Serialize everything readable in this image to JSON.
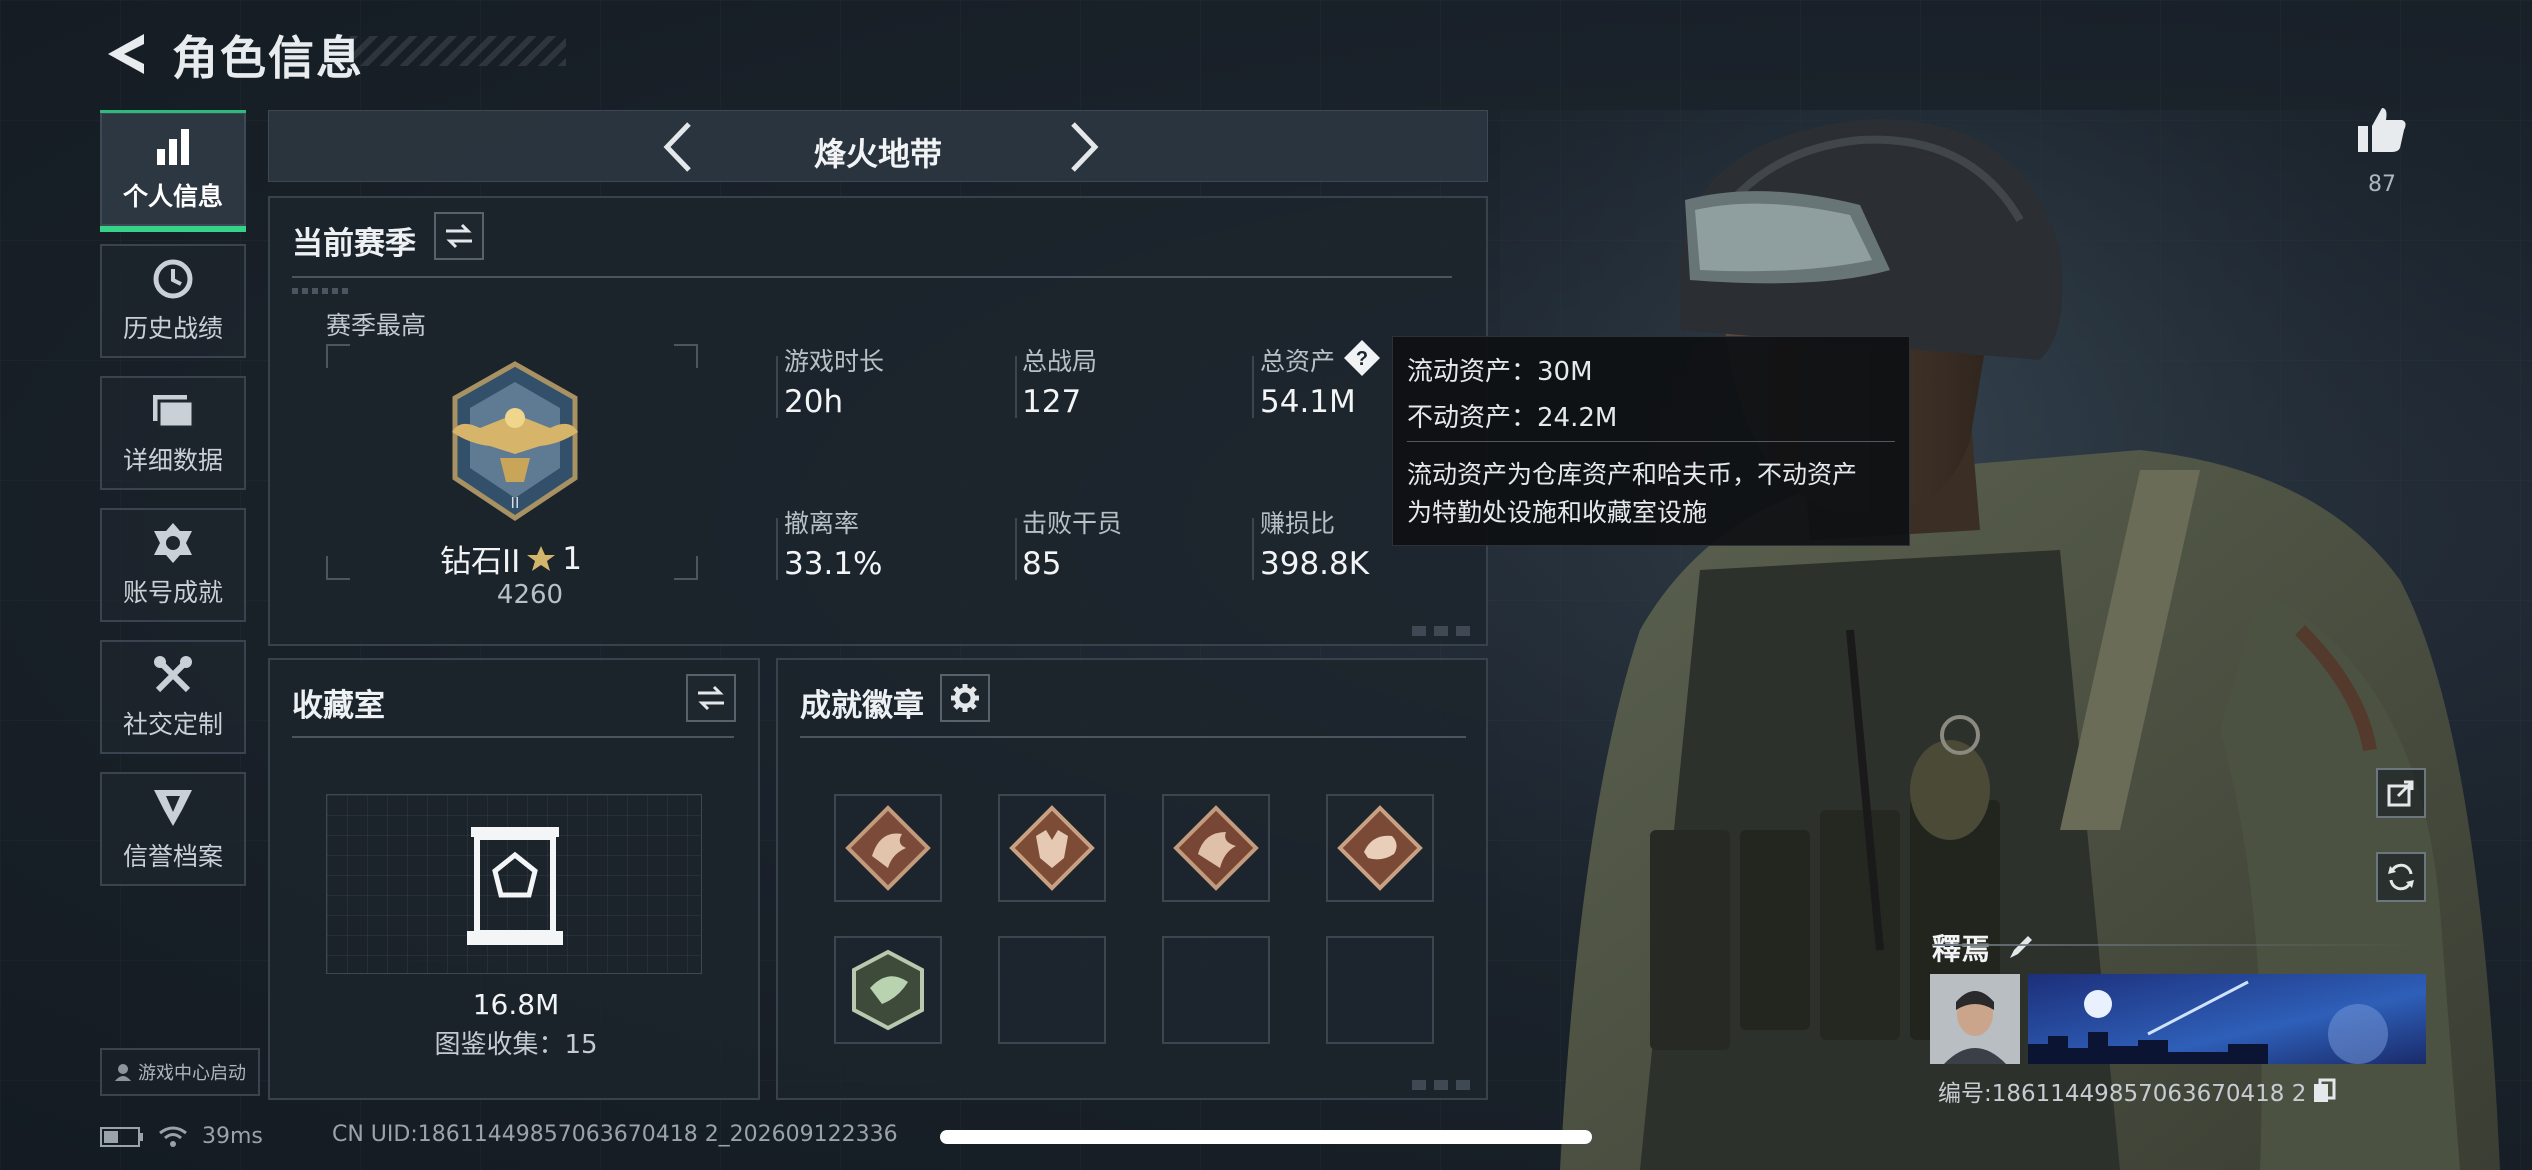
{
  "header": {
    "title": "角色信息"
  },
  "sidebar": {
    "items": [
      {
        "label": "个人信息",
        "icon": "bar-chart-icon",
        "active": true
      },
      {
        "label": "历史战绩",
        "icon": "clock-icon",
        "active": false
      },
      {
        "label": "详细数据",
        "icon": "folder-icon",
        "active": false
      },
      {
        "label": "账号成就",
        "icon": "medal-icon",
        "active": false
      },
      {
        "label": "社交定制",
        "icon": "tools-icon",
        "active": false
      },
      {
        "label": "信誉档案",
        "icon": "emblem-icon",
        "active": false
      }
    ],
    "launch_label": "游戏中心启动"
  },
  "mode": {
    "title": "烽火地带"
  },
  "season": {
    "title": "当前赛季",
    "best_label": "赛季最高",
    "rank_name": "钻石II",
    "rank_stars": "1",
    "rank_score": "4260",
    "stats": [
      {
        "label": "游戏时长",
        "value": "20h"
      },
      {
        "label": "总战局",
        "value": "127"
      },
      {
        "label": "总资产",
        "value": "54.1M",
        "has_help": true
      },
      {
        "label": "撤离率",
        "value": "33.1%"
      },
      {
        "label": "击败干员",
        "value": "85"
      },
      {
        "label": "赚损比",
        "value": "398.8K"
      }
    ]
  },
  "tooltip": {
    "line1": "流动资产：30M",
    "line2": "不动资产：24.2M",
    "desc1": "流动资产为仓库资产和哈夫币，不动资产",
    "desc2": "为特勤处设施和收藏室设施"
  },
  "collection": {
    "title": "收藏室",
    "value": "16.8M",
    "count_label": "图鉴收集：15"
  },
  "badges": {
    "title": "成就徽章",
    "slots": [
      "dragon-badge",
      "wolf-badge",
      "dragon-badge-2",
      "lizard-badge",
      "wasp-badge",
      "empty",
      "empty",
      "empty"
    ]
  },
  "likes": {
    "count": "87"
  },
  "profile": {
    "name": "釋焉",
    "id_label": "编号:18611449857063670418 2"
  },
  "status": {
    "ping": "39ms",
    "uid": "CN UID:18611449857063670418 2_202609122336"
  },
  "colors": {
    "accent": "#35d38a",
    "panel": "#1c242c",
    "border": "#38424d"
  }
}
